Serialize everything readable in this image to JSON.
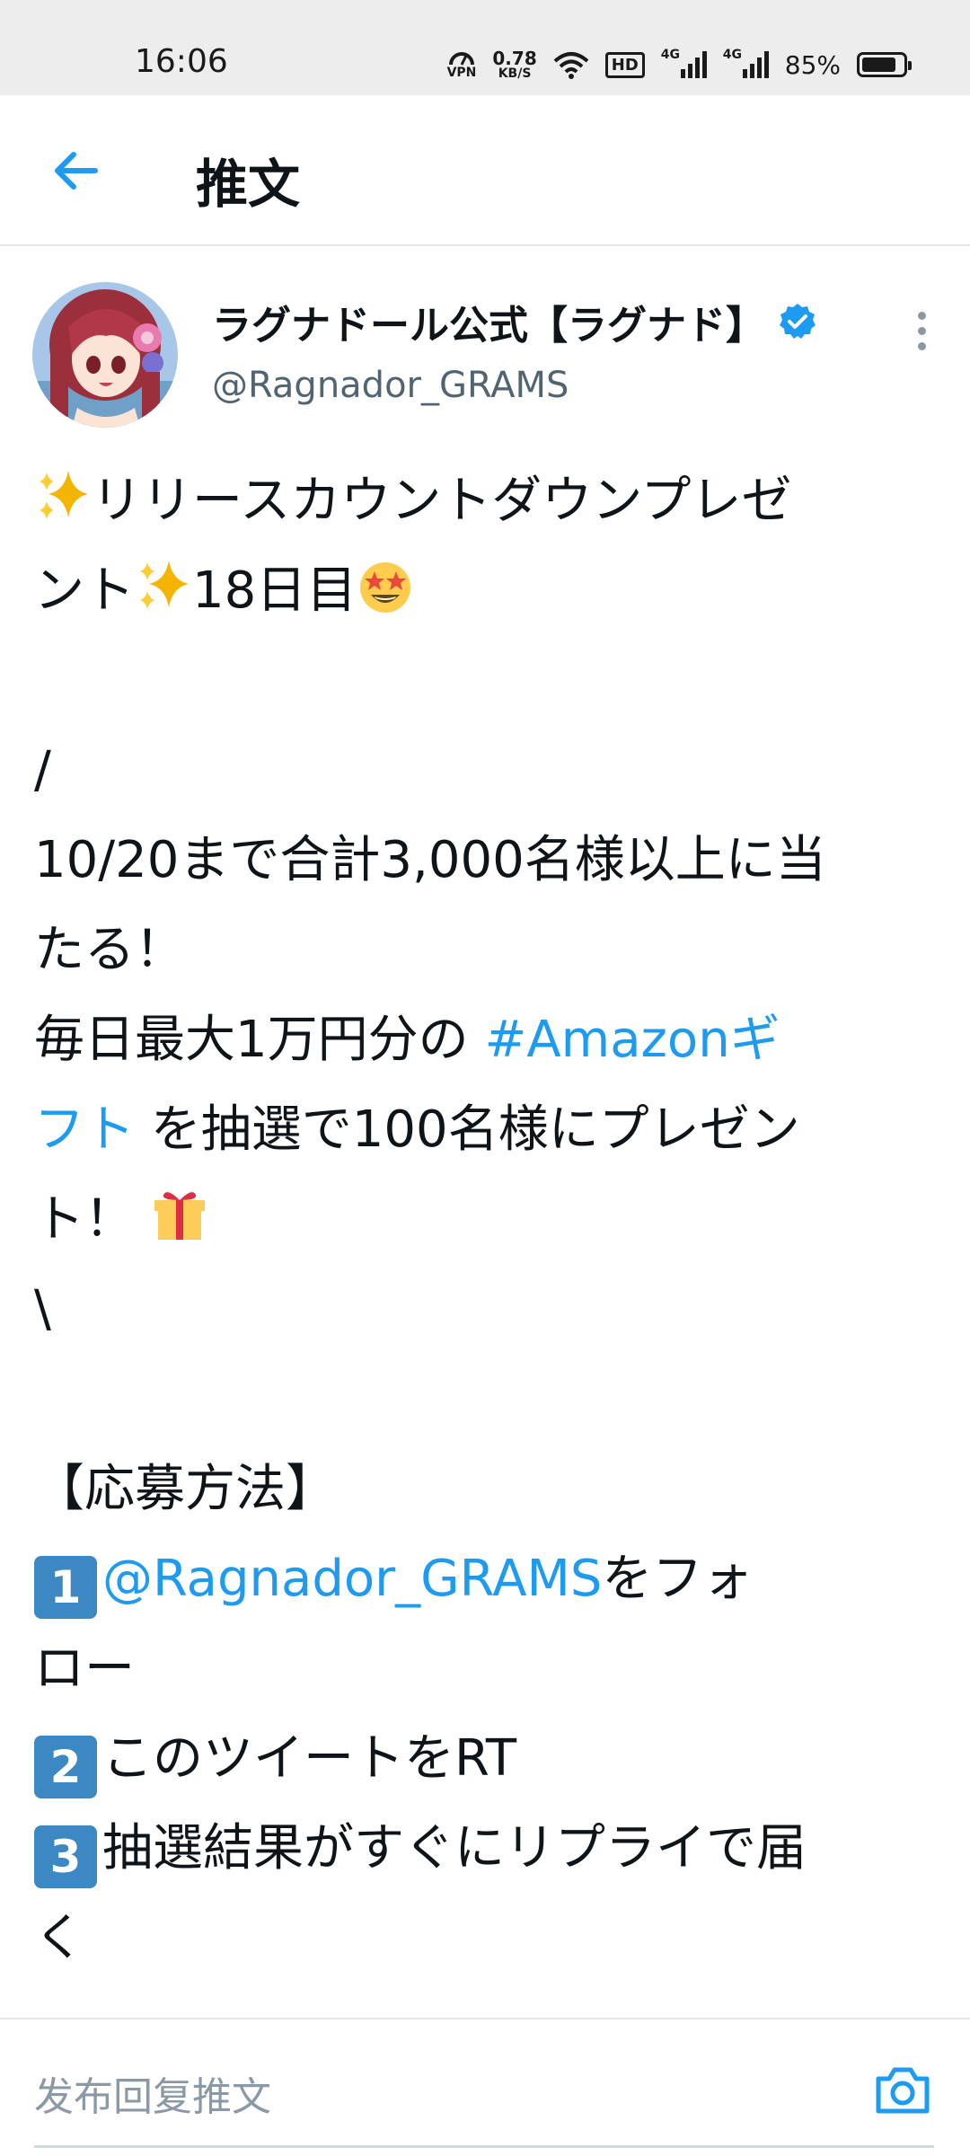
{
  "status_bar": {
    "time": "16:06",
    "vpn": "VPN",
    "net_speed_value": "0.78",
    "net_speed_unit": "KB/S",
    "hd": "HD",
    "signal1": "4G",
    "signal2": "4G",
    "battery_percent": "85%",
    "battery_level": 0.85
  },
  "header": {
    "title": "推文",
    "back_icon": "arrow-left-icon",
    "accent": "#1d9bf0"
  },
  "tweet": {
    "author": {
      "display_name": "ラグナドール公式【ラグナド】",
      "handle": "@Ragnador_GRAMS",
      "verified": true
    },
    "lines": {
      "l1": "リリースカウントダウンプレゼ",
      "l2a": "ント",
      "l2b": "18日目",
      "l4": " /",
      "l5": "10/20まで合計3,000名様以上に当",
      "l6": "たる！",
      "l7a": "毎日最大1万円分の ",
      "l7b": "#Amazonギ",
      "l8a": "フト",
      "l8b": " を抽選で100名様にプレゼン",
      "l9": "ト！ ",
      "l10": " \\",
      "l12": " 【応募方法】",
      "l13a": "@Ragnador_GRAMS",
      "l13b": "をフォ",
      "l14": "ロー",
      "l15": "このツイートをRT",
      "l16": "抽選結果がすぐにリプライで届",
      "l17": "く"
    },
    "keycaps": [
      "1",
      "2",
      "3"
    ]
  },
  "reply_bar": {
    "placeholder": "发布回复推文",
    "camera_icon": "camera-icon"
  }
}
